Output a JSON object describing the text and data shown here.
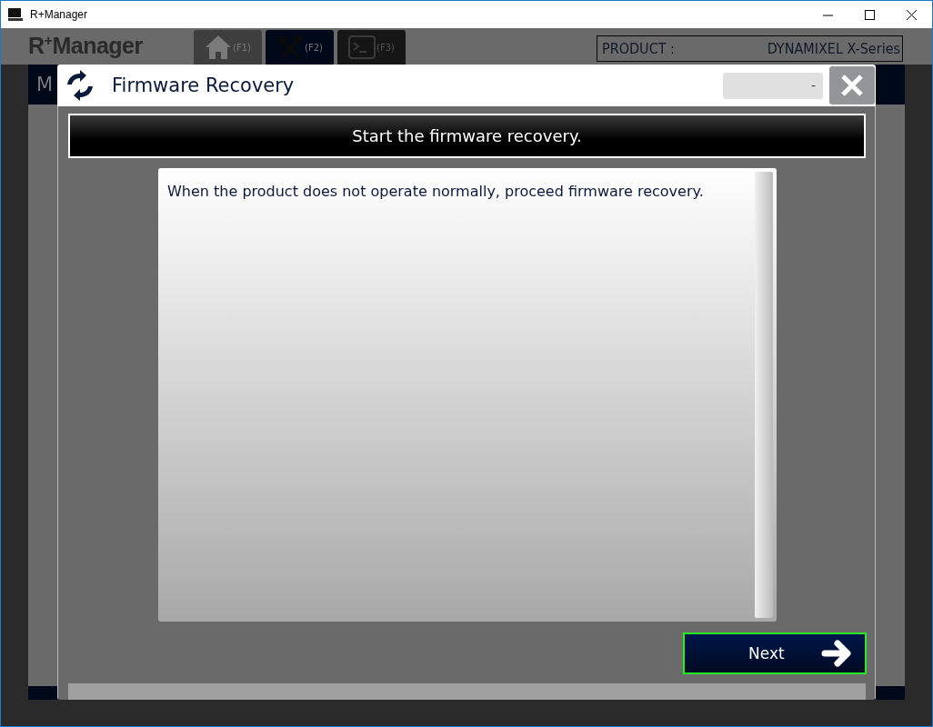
{
  "window": {
    "title": "R+Manager"
  },
  "app": {
    "logo": "R$^{+}$Manager",
    "tabs": [
      {
        "kind": "home",
        "key": "(F1)",
        "selected": false
      },
      {
        "kind": "tools",
        "key": "(F2)",
        "selected": true
      },
      {
        "kind": "terminal",
        "key": "(F3)",
        "selected": false
      }
    ],
    "product": {
      "label": "PRODUCT :",
      "value": "DYNAMIXEL X-Series"
    },
    "menu_text": "M"
  },
  "dialog": {
    "title": "Firmware Recovery",
    "status": "-",
    "banner": "Start the firmware recovery.",
    "message": "When the product does not operate normally, proceed firmware recovery.",
    "next_button": "Next"
  }
}
